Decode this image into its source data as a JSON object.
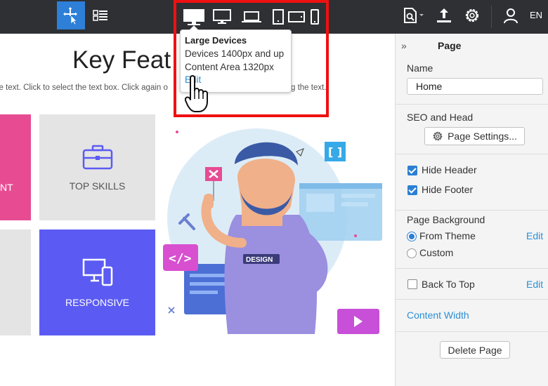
{
  "toolbar": {
    "icons": [
      "move-select-icon",
      "layers-icon",
      "large-device-icon",
      "desktop-icon",
      "laptop-icon",
      "tablet-portrait-icon",
      "tablet-landscape-icon",
      "phone-icon",
      "page-file-icon",
      "export-icon",
      "gear-icon",
      "user-icon"
    ],
    "language": "EN",
    "accent_color": "#2e7fd8"
  },
  "tooltip": {
    "title": "Large Devices",
    "line1": "Devices 1400px and up",
    "line2": "Content Area 1320px",
    "edit_label": "Edit",
    "highlight_color": "#ee1111"
  },
  "canvas": {
    "heading": "Key Feat",
    "subtext_left": "le text. Click to select the text box. Click again o",
    "subtext_right": "g the text.",
    "cards": [
      {
        "label": "NT",
        "color": "#e74c93"
      },
      {
        "label": "TOP SKILLS",
        "icon": "briefcase-icon",
        "color": "#e4e4e4"
      },
      {
        "label": "",
        "color": "#e4e4e4"
      },
      {
        "label": "RESPONSIVE",
        "icon": "devices-icon",
        "color": "#5b5bf3"
      }
    ],
    "illustration_badge": "DESIGN"
  },
  "panel": {
    "title": "Page",
    "name_label": "Name",
    "name_value": "Home",
    "seo_label": "SEO and Head",
    "page_settings_button": "Page Settings...",
    "hide_header_label": "Hide Header",
    "hide_header_checked": true,
    "hide_footer_label": "Hide Footer",
    "hide_footer_checked": true,
    "background_label": "Page Background",
    "from_theme_label": "From Theme",
    "custom_label": "Custom",
    "edit_label": "Edit",
    "back_to_top_label": "Back To Top",
    "back_to_top_checked": false,
    "content_width_label": "Content Width",
    "delete_page_button": "Delete Page",
    "link_color": "#2b8fd6"
  }
}
